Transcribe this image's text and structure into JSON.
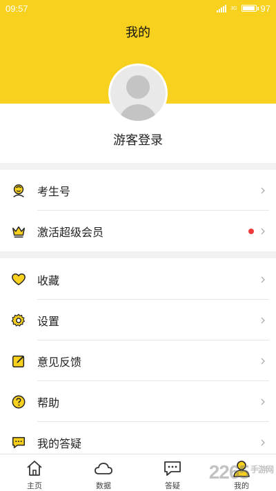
{
  "status": {
    "time": "09:57",
    "network": "3G",
    "battery": "97",
    "battery_level": 0.97
  },
  "header": {
    "title": "我的",
    "bg_color": "#f7d11e"
  },
  "profile": {
    "login_label": "游客登录"
  },
  "menu_group_1": [
    {
      "label": "考生号",
      "icon": "user-smile-icon"
    },
    {
      "label": "激活超级会员",
      "icon": "crown-icon",
      "badge_dot": true
    }
  ],
  "menu_group_2": [
    {
      "label": "收藏",
      "icon": "heart-icon"
    },
    {
      "label": "设置",
      "icon": "gear-icon"
    },
    {
      "label": "意见反馈",
      "icon": "edit-icon"
    },
    {
      "label": "帮助",
      "icon": "help-icon"
    },
    {
      "label": "我的答疑",
      "icon": "chat-icon"
    }
  ],
  "tabs": [
    {
      "label": "主页",
      "icon": "home-icon",
      "active": false
    },
    {
      "label": "数据",
      "icon": "cloud-icon",
      "active": false
    },
    {
      "label": "答疑",
      "icon": "chat-bubble-icon",
      "active": false
    },
    {
      "label": "我的",
      "icon": "person-icon",
      "active": true
    }
  ],
  "watermark": {
    "number": "2265",
    "site": "手游网"
  },
  "colors": {
    "accent": "#f7d11e",
    "badge": "#ef3b3b",
    "icon_stroke": "#222222"
  }
}
